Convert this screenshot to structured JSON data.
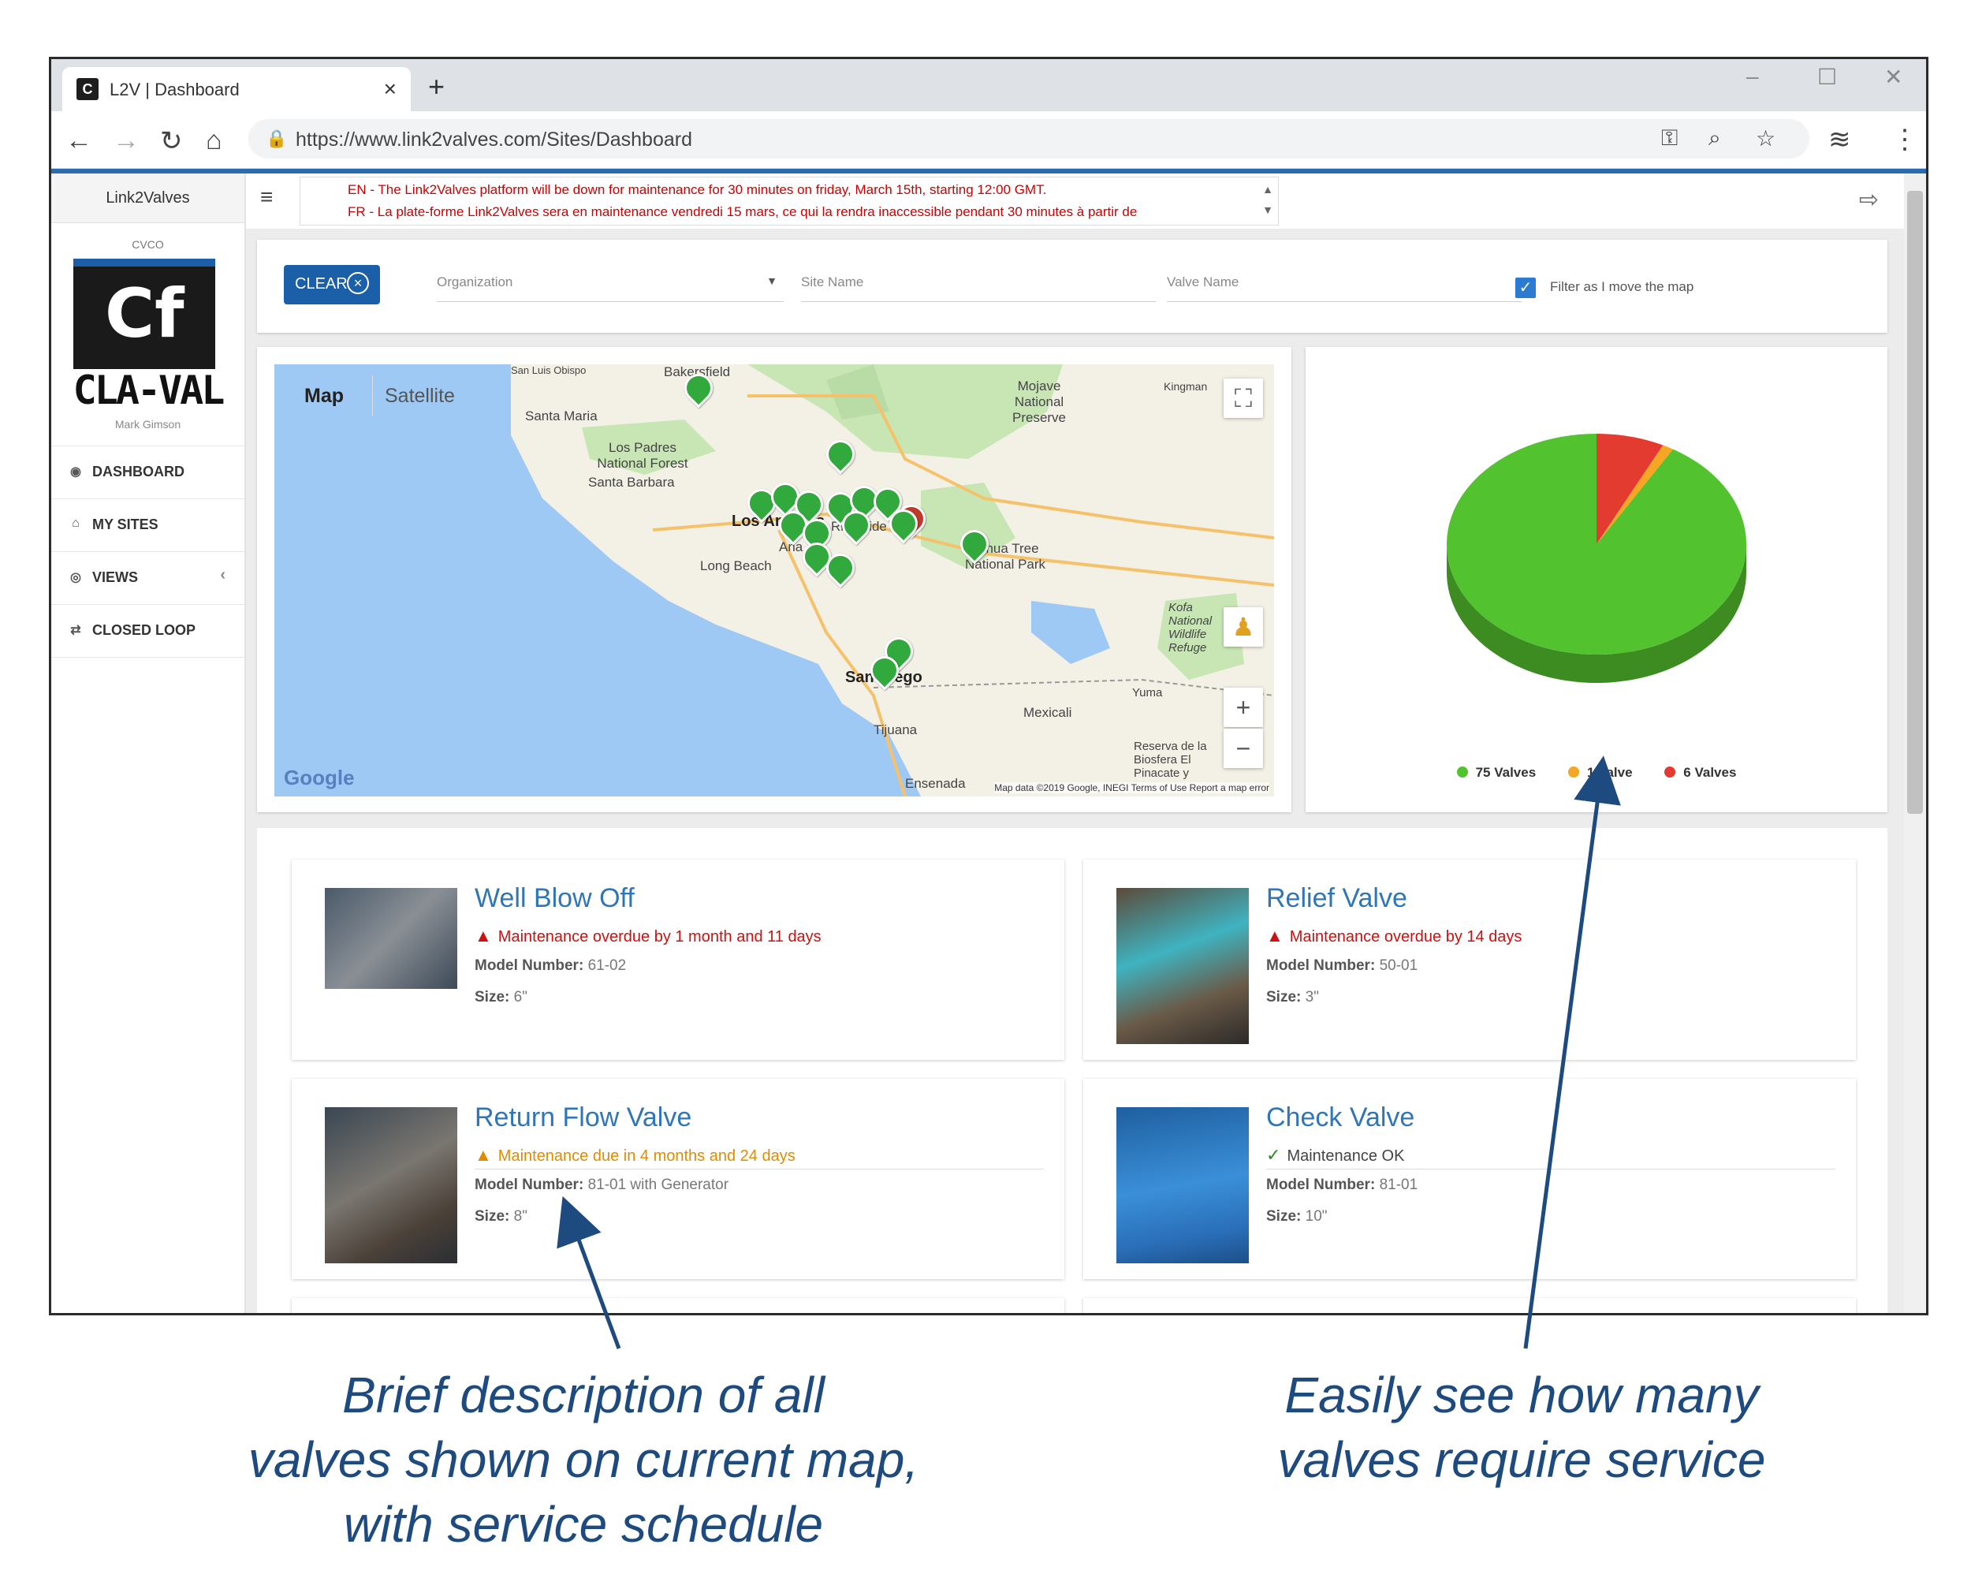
{
  "browser": {
    "tab_title": "L2V | Dashboard",
    "url": "https://www.link2valves.com/Sites/Dashboard"
  },
  "sidebar": {
    "brand": "Link2Valves",
    "cvco": "CVCO",
    "logo_text": "CLA-VAL",
    "user": "Mark Gimson",
    "items": [
      {
        "label": "DASHBOARD",
        "icon": "dashboard-icon"
      },
      {
        "label": "MY SITES",
        "icon": "home-icon"
      },
      {
        "label": "VIEWS",
        "icon": "eye-icon"
      },
      {
        "label": "CLOSED LOOP",
        "icon": "loop-icon"
      }
    ]
  },
  "notice": {
    "en": "EN - The Link2Valves platform will be down for maintenance for 30 minutes on friday, March 15th, starting 12:00 GMT.",
    "fr": "FR - La plate-forme Link2Valves sera en maintenance vendredi 15 mars, ce qui la rendra inaccessible pendant 30 minutes à partir de"
  },
  "filters": {
    "clear_label": "CLEAR",
    "organization_placeholder": "Organization",
    "site_name_placeholder": "Site Name",
    "valve_name_placeholder": "Valve Name",
    "filter_move_label": "Filter as I move the map"
  },
  "map": {
    "type_map": "Map",
    "type_satellite": "Satellite",
    "google": "Google",
    "credit": "Map data ©2019 Google, INEGI  Terms of Use  Report a map error",
    "labels": {
      "bakersfield": "Bakersfield",
      "san_luis_obispo": "San Luis Obispo",
      "santa_maria": "Santa Maria",
      "los_padres": "Los Padres National Forest",
      "santa_barbara": "Santa Barbara",
      "mojave": "Mojave National Preserve",
      "kingman": "Kingman",
      "los_angeles": "Los Angeles",
      "long_beach": "Long Beach",
      "anaheim": "Ana",
      "riverside": "Riverside",
      "joshua_tree": "Joshua Tree National Park",
      "kofa": "Kofa National Wildlife Refuge",
      "san_diego": "San Diego",
      "yuma": "Yuma",
      "mexicali": "Mexicali",
      "tijuana": "Tijuana",
      "ensenada": "Ensenada",
      "reserva": "Reserva de la Biosfera El Pinacate y"
    }
  },
  "chart_data": {
    "type": "pie",
    "categories": [
      "75 Valves",
      "1 Valve",
      "6 Valves"
    ],
    "values": [
      75,
      1,
      6
    ],
    "colors": [
      "#53c22f",
      "#f5a623",
      "#e33b2f"
    ]
  },
  "valves": [
    {
      "title": "Well Blow Off",
      "status": "Maintenance overdue by 1 month and 11 days",
      "status_level": "overdue",
      "model_label": "Model Number:",
      "model": "61-02",
      "size_label": "Size:",
      "size": "6\""
    },
    {
      "title": "Relief Valve",
      "status": "Maintenance overdue by 14 days",
      "status_level": "overdue",
      "model_label": "Model Number:",
      "model": "50-01",
      "size_label": "Size:",
      "size": "3\""
    },
    {
      "title": "Return Flow Valve",
      "status": "Maintenance due in 4 months and 24 days",
      "status_level": "due",
      "model_label": "Model Number:",
      "model": "81-01 with Generator",
      "size_label": "Size:",
      "size": "8\""
    },
    {
      "title": "Check Valve",
      "status": "Maintenance OK",
      "status_level": "ok",
      "model_label": "Model Number:",
      "model": "81-01",
      "size_label": "Size:",
      "size": "10\""
    }
  ],
  "captions": {
    "left_1": "Brief description of all",
    "left_2": "valves shown on current map,",
    "left_3": "with service schedule",
    "right_1": "Easily see how many",
    "right_2": "valves require service"
  },
  "colors": {
    "accent": "#1a5fa8",
    "caption": "#1d4a7f",
    "overdue": "#cc1111",
    "due": "#e38b00",
    "ok": "#2a8a2a",
    "pin": "#32a93d"
  }
}
